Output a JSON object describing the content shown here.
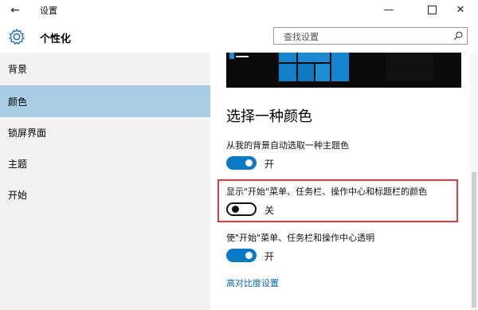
{
  "titlebar": {
    "title": "设置",
    "back_icon": "back-arrow-icon",
    "minimize_glyph": "—",
    "close_glyph": "✕"
  },
  "header": {
    "title": "个性化",
    "search": {
      "placeholder": "查找设置"
    }
  },
  "sidebar": {
    "items": [
      {
        "label": "背景",
        "selected": false
      },
      {
        "label": "颜色",
        "selected": true
      },
      {
        "label": "锁屏界面",
        "selected": false
      },
      {
        "label": "主题",
        "selected": false
      },
      {
        "label": "开始",
        "selected": false
      }
    ]
  },
  "main": {
    "section_title": "选择一种颜色",
    "settings": [
      {
        "label": "从我的背景自动选取一种主题色",
        "state": "开",
        "on": true
      },
      {
        "label": "显示\"开始\"菜单、任务栏、操作中心和标题栏的颜色",
        "state": "关",
        "on": false
      },
      {
        "label": "使\"开始\"菜单、任务栏和操作中心透明",
        "state": "开",
        "on": true
      }
    ],
    "link": "高对比度设置"
  },
  "colors": {
    "accent": "#0a7ac7",
    "selected_nav": "#a8cde5",
    "highlight_box": "#e23b3b",
    "link": "#0a66b7"
  }
}
